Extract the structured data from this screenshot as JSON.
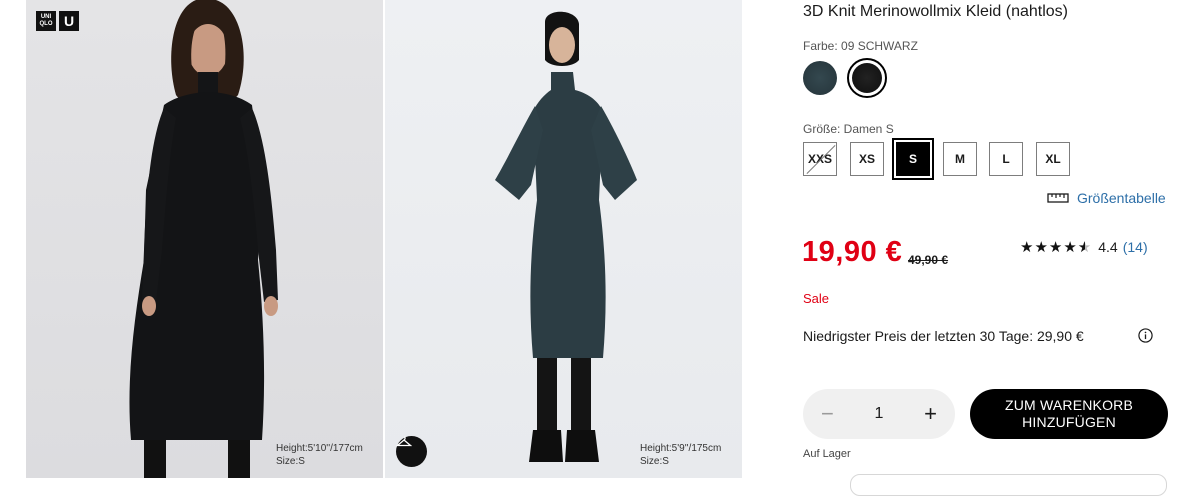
{
  "gallery": {
    "logo": {
      "line1": "UNI",
      "line2": "QLO",
      "letter": "U"
    },
    "photo1": {
      "height": "Height:5'10''/177cm",
      "size": "Size:S",
      "dress_color": "#131416"
    },
    "photo2": {
      "height": "Height:5'9''/175cm",
      "size": "Size:S",
      "dress_color": "#2c3d44",
      "icon": "hanger-icon"
    }
  },
  "product": {
    "title": "3D Knit Merinowollmix Kleid (nahtlos)",
    "color_label": "Farbe: 09 SCHWARZ",
    "swatches": [
      {
        "name": "dark-teal",
        "color": "#2c3d44",
        "selected": false
      },
      {
        "name": "black",
        "color": "#151515",
        "selected": true
      }
    ],
    "size_label": "Größe: Damen S",
    "sizes": [
      {
        "label": "XXS",
        "state": "disabled"
      },
      {
        "label": "XS",
        "state": "available"
      },
      {
        "label": "S",
        "state": "selected"
      },
      {
        "label": "M",
        "state": "available"
      },
      {
        "label": "L",
        "state": "available"
      },
      {
        "label": "XL",
        "state": "available"
      }
    ],
    "size_chart_label": "Größentabelle",
    "price": "19,90 €",
    "old_price": "49,90 €",
    "rating": {
      "stars": "★★★★",
      "half_star": "★",
      "score": "4.4",
      "count": "(14)",
      "value": 4.4
    },
    "sale_label": "Sale",
    "lowest_price": "Niedrigster Preis der letzten 30 Tage: 29,90 €",
    "quantity": {
      "minus": "−",
      "value": "1",
      "plus": "+"
    },
    "cart_button": {
      "line1": "ZUM WARENKORB",
      "line2": "HINZUFÜGEN"
    },
    "stock": "Auf Lager"
  },
  "colors": {
    "sale_red": "#e00014",
    "link_blue": "#2d6fa8"
  }
}
